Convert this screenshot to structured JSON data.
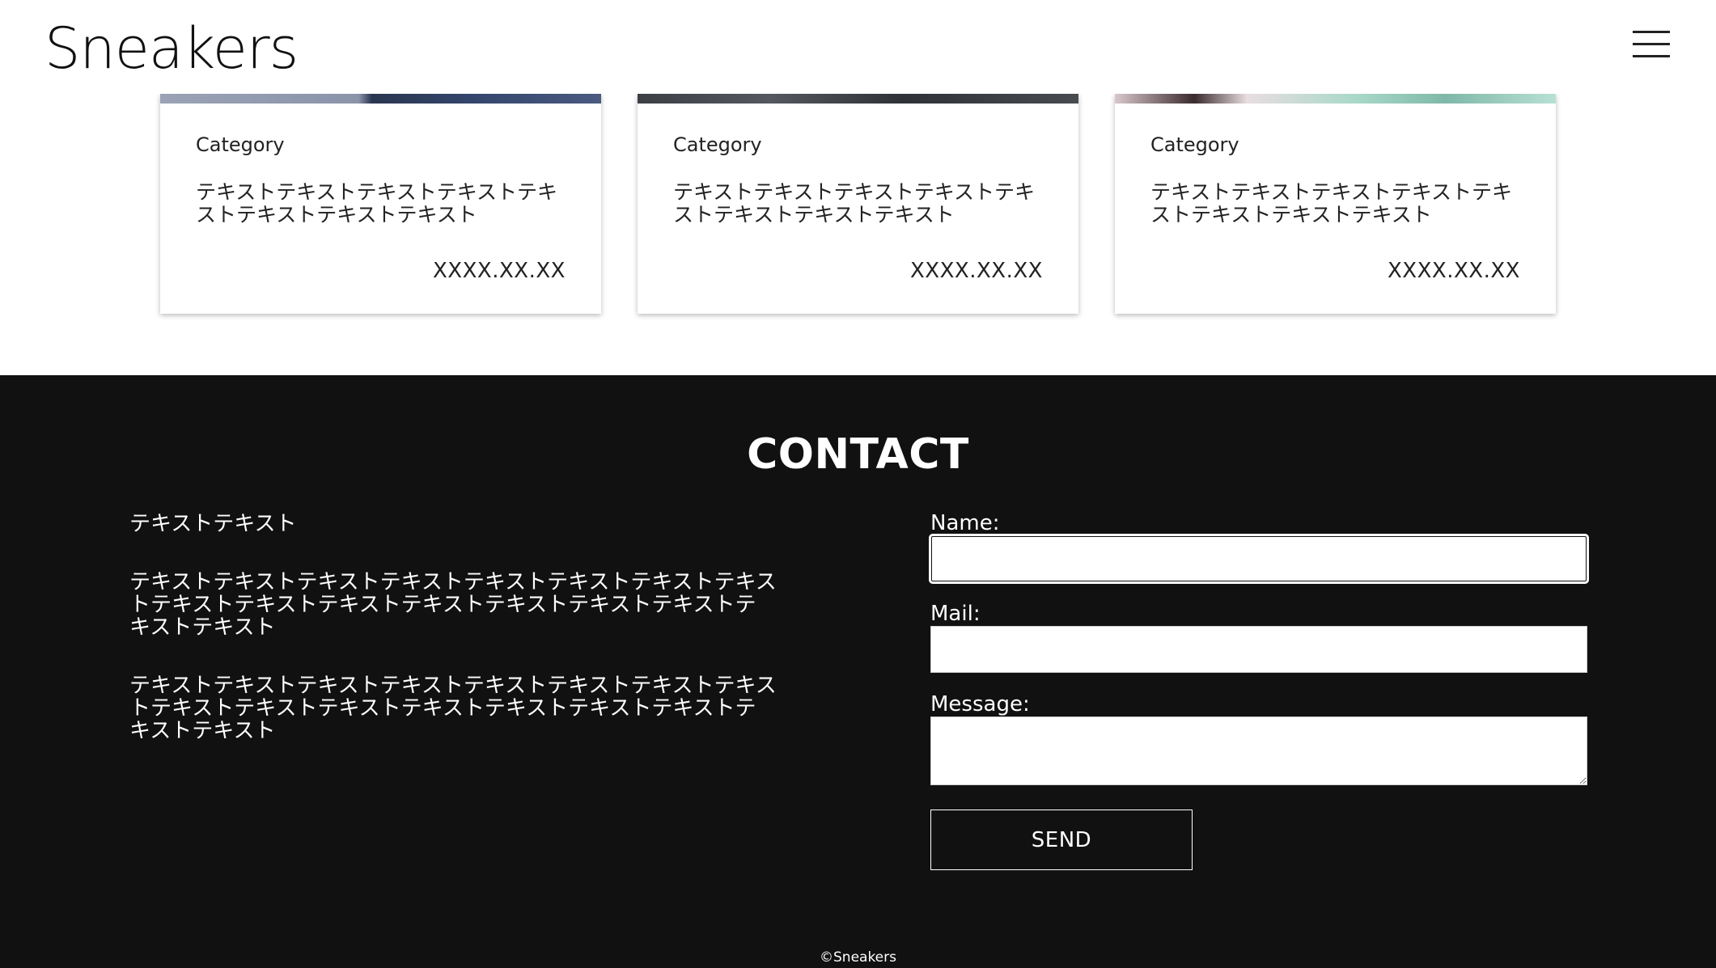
{
  "header": {
    "logo": "Sneakers",
    "menu_icon": "hamburger-menu-icon"
  },
  "cards": [
    {
      "category": "Category",
      "text": "テキストテキストテキストテキストテキストテキストテキストテキスト",
      "date": "XXXX.XX.XX",
      "image_color": "#3a4a6a"
    },
    {
      "category": "Category",
      "text": "テキストテキストテキストテキストテキストテキストテキストテキスト",
      "date": "XXXX.XX.XX",
      "image_color": "#3b3f44"
    },
    {
      "category": "Category",
      "text": "テキストテキストテキストテキストテキストテキストテキストテキスト",
      "date": "XXXX.XX.XX",
      "image_color": "#7fb8a8"
    }
  ],
  "contact": {
    "title": "CONTACT",
    "lead": "テキストテキスト",
    "paragraphs": [
      "テキストテキストテキストテキストテキストテキストテキストテキストテキストテキストテキストテキストテキストテキストテキストテキストテキスト",
      "テキストテキストテキストテキストテキストテキストテキストテキストテキストテキストテキストテキストテキストテキストテキストテキストテキスト"
    ],
    "form": {
      "name_label": "Name:",
      "name_value": "",
      "mail_label": "Mail:",
      "mail_value": "",
      "message_label": "Message:",
      "message_value": "",
      "send_label": "SEND"
    }
  },
  "footer": {
    "copyright": "©Sneakers"
  },
  "colors": {
    "contact_bg": "#111111",
    "page_bg": "#ffffff"
  }
}
